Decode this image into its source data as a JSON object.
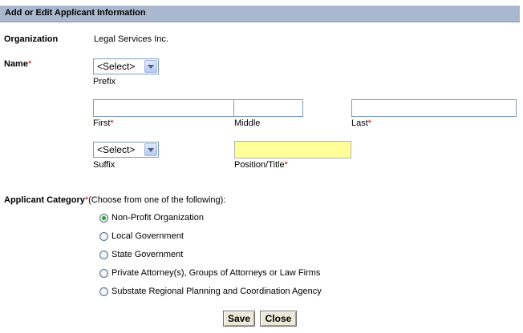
{
  "header": {
    "title": "Add or Edit Applicant Information"
  },
  "organization": {
    "label": "Organization",
    "value": "Legal Services Inc."
  },
  "name": {
    "label": "Name",
    "required_mark": "*",
    "prefix": {
      "value": "<Select>",
      "caption": "Prefix"
    },
    "first": {
      "value": "",
      "caption": "First"
    },
    "middle": {
      "value": "",
      "caption": "Middle"
    },
    "last": {
      "value": "",
      "caption": "Last"
    },
    "suffix": {
      "value": "<Select>",
      "caption": "Suffix"
    },
    "position": {
      "value": "",
      "caption": "Position/Title"
    }
  },
  "category": {
    "label": "Applicant Category",
    "required_mark": "*",
    "hint": "(Choose from one of the following):",
    "options": [
      {
        "label": "Non-Profit Organization",
        "selected": true
      },
      {
        "label": "Local Government",
        "selected": false
      },
      {
        "label": "State Government",
        "selected": false
      },
      {
        "label": "Private Attorney(s), Groups of Attorneys or Law Firms",
        "selected": false
      },
      {
        "label": "Substate Regional Planning and Coordination Agency",
        "selected": false
      }
    ]
  },
  "buttons": {
    "save": "Save",
    "close": "Close"
  },
  "colors": {
    "header_bg": "#a9b8cf",
    "required": "#c00000",
    "highlight_field": "#ffff99",
    "radio_selected": "#2fa336"
  }
}
